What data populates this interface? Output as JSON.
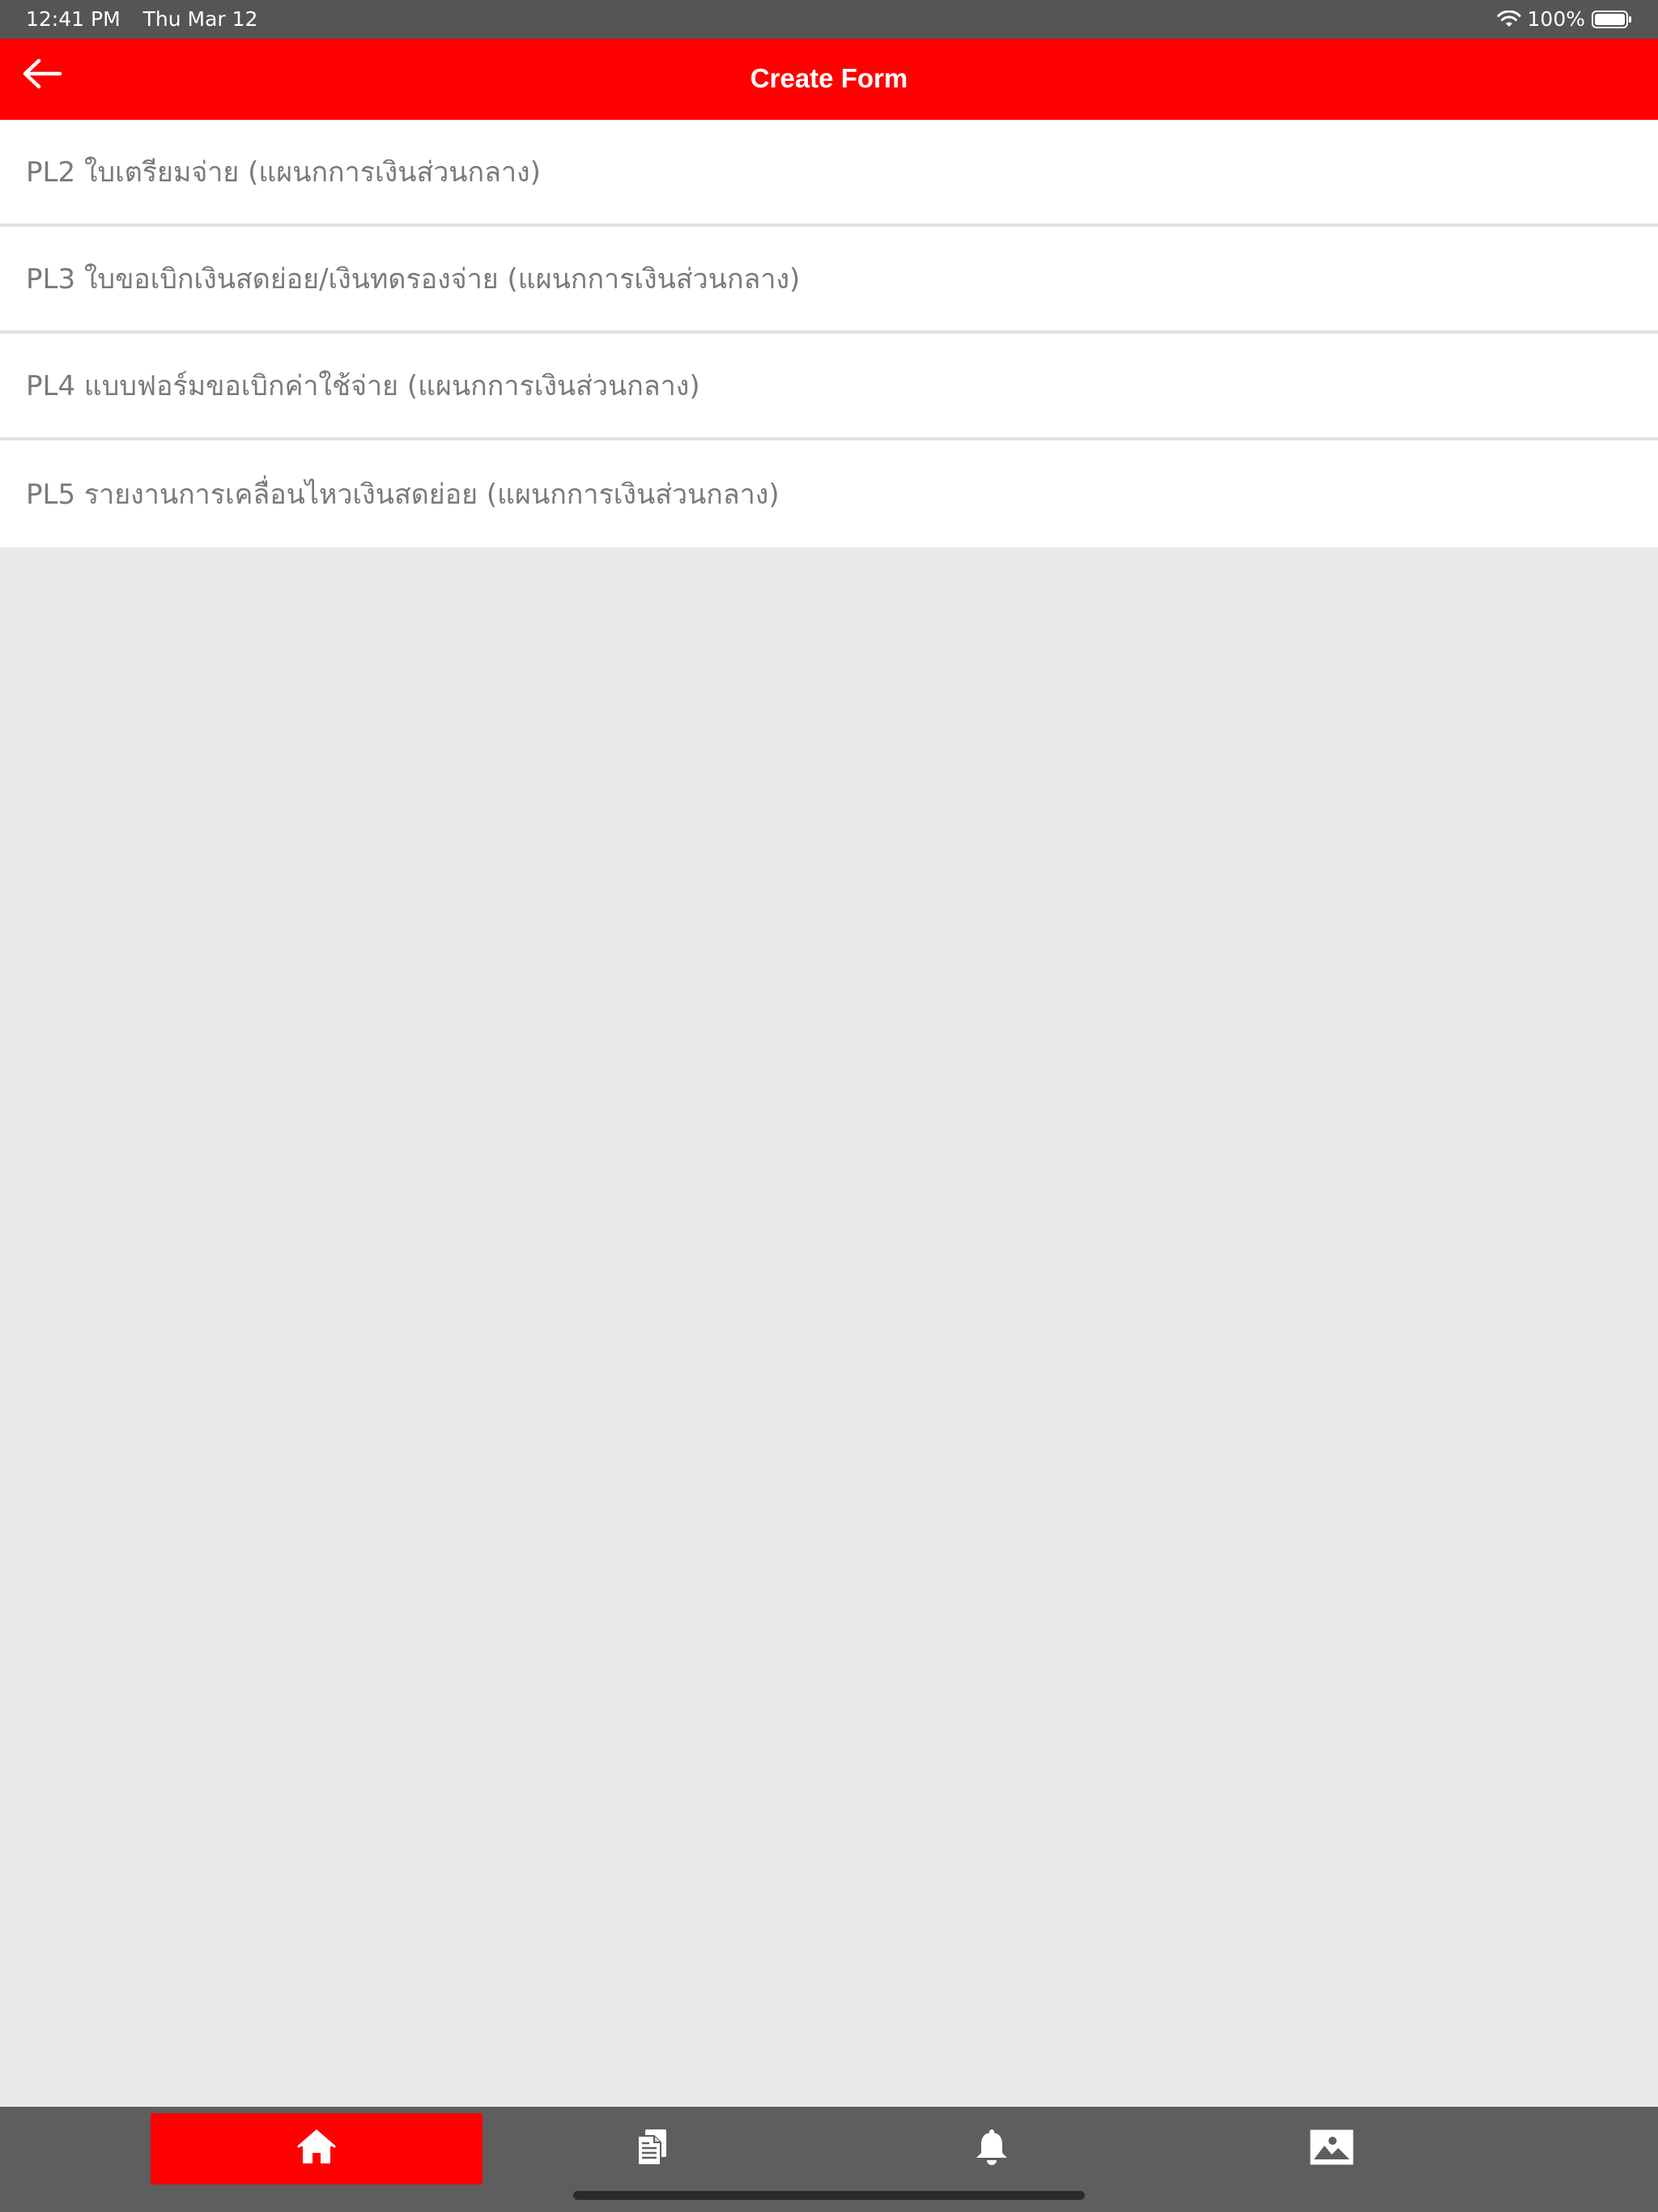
{
  "status_bar": {
    "time": "12:41 PM",
    "date": "Thu Mar 12",
    "battery": "100%",
    "wifi_icon": "wifi-icon",
    "battery_icon": "battery-icon"
  },
  "nav": {
    "title": "Create Form",
    "back_icon": "arrow-left-icon",
    "color": "#ff0000"
  },
  "forms": [
    {
      "label": "PL2 ใบเตรียมจ่าย (แผนกการเงินส่วนกลาง)"
    },
    {
      "label": "PL3 ใบขอเบิกเงินสดย่อย/เงินทดรองจ่าย (แผนกการเงินส่วนกลาง)"
    },
    {
      "label": "PL4 แบบฟอร์มขอเบิกค่าใช้จ่าย (แผนกการเงินส่วนกลาง)"
    },
    {
      "label": "PL5 รายงานการเคลื่อนไหวเงินสดย่อย (แผนกการเงินส่วนกลาง)"
    }
  ],
  "bottom_tabs": [
    {
      "icon": "home-icon",
      "active": true
    },
    {
      "icon": "document-icon",
      "active": false
    },
    {
      "icon": "bell-icon",
      "active": false
    },
    {
      "icon": "image-icon",
      "active": false
    }
  ],
  "colors": {
    "accent": "#ff0000",
    "status_bar": "#555555",
    "bottom_bar": "#5e5e5e",
    "background": "#e9e9e9",
    "item_text": "#7a7a7a"
  }
}
